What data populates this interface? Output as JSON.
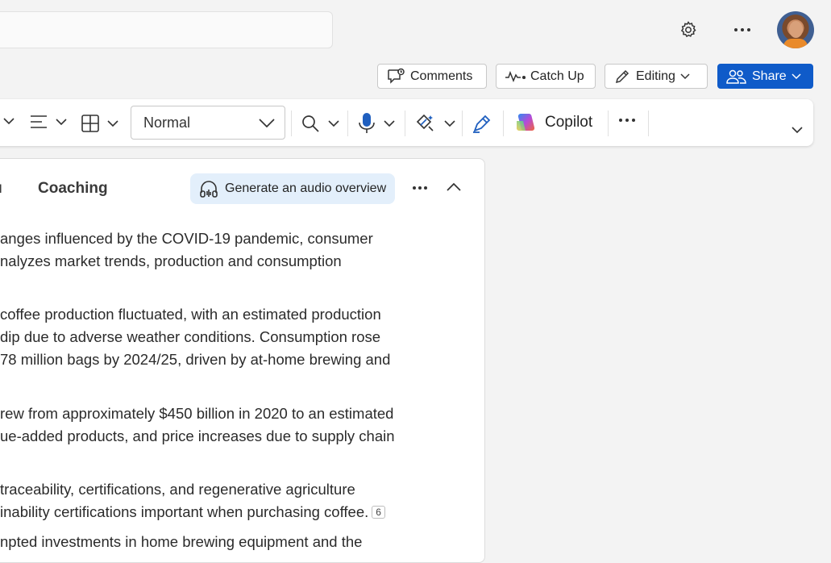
{
  "topbar": {
    "settings_icon": "gear-icon",
    "more_icon": "ellipsis-icon",
    "avatar_icon": "user-avatar"
  },
  "actions": {
    "comments_label": "Comments",
    "catchup_label": "Catch Up",
    "editing_label": "Editing",
    "share_label": "Share"
  },
  "ribbon": {
    "style_value": "Normal",
    "copilot_label": "Copilot"
  },
  "panel": {
    "tab_label": "Coaching",
    "audio_button_label": "Generate an audio overview",
    "paragraphs": [
      [
        "anges influenced by the COVID-19 pandemic, consumer",
        "nalyzes market trends, production and consumption"
      ],
      [
        "coffee production fluctuated, with an estimated production",
        "dip due to adverse weather conditions. Consumption rose",
        "78 million bags by 2024/25, driven by at-home brewing and"
      ],
      [
        "rew from approximately $450 billion in 2020 to an estimated",
        "ue-added products, and price increases due to supply chain"
      ],
      [
        "traceability, certifications, and regenerative agriculture",
        "inability certifications important when purchasing coffee."
      ],
      [
        "npted investments in home brewing equipment and the"
      ]
    ],
    "citation": "6"
  },
  "colors": {
    "accent": "#0f5bc9",
    "panel_highlight": "#e3effb"
  }
}
